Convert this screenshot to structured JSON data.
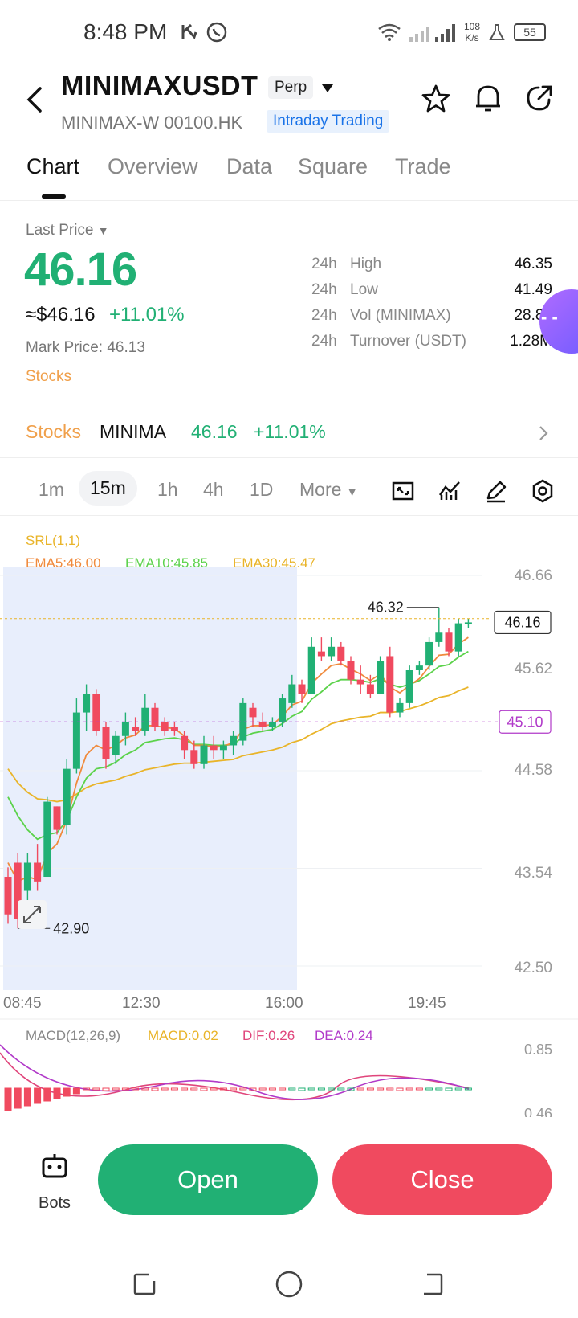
{
  "status": {
    "time": "8:48 PM",
    "net_speed_top": "108",
    "net_speed_bottom": "K/s",
    "battery": "55"
  },
  "header": {
    "title": "MINIMAXUSDT",
    "badge": "Perp",
    "subtitle": "MINIMAX-W 00100.HK",
    "tag": "Intraday Trading"
  },
  "tabs": [
    "Chart",
    "Overview",
    "Data",
    "Square",
    "Trade"
  ],
  "price": {
    "label": "Last Price",
    "value": "46.16",
    "usd": "≈$46.16",
    "change": "+11.01%",
    "mark": "Mark Price: 46.13",
    "category": "Stocks"
  },
  "stats": [
    {
      "p": "24h",
      "label": "High",
      "value": "46.35"
    },
    {
      "p": "24h",
      "label": "Low",
      "value": "41.49"
    },
    {
      "p": "24h",
      "label": "Vol (MINIMAX)",
      "value": "28.82"
    },
    {
      "p": "24h",
      "label": "Turnover (USDT)",
      "value": "1.28M"
    }
  ],
  "ticker": {
    "category": "Stocks",
    "name": "MINIMA",
    "price": "46.16",
    "change": "+11.01%"
  },
  "intervals": [
    "1m",
    "15m",
    "1h",
    "4h",
    "1D",
    "More"
  ],
  "colors": {
    "up": "#21b074",
    "down": "#f04a5f",
    "ema5": "#f08a3c",
    "ema10": "#5bd24a",
    "ema30": "#e9b429",
    "dif": "#e0457b",
    "dea": "#b13ac9"
  },
  "chart_data": {
    "type": "candlestick",
    "indicator_top": "SRL(1,1)",
    "legend": [
      "EMA5:46.00",
      "EMA10:45.85",
      "EMA30:45.47"
    ],
    "y_ticks": [
      "46.66",
      "45.62",
      "44.58",
      "43.54",
      "42.50"
    ],
    "x_ticks": [
      "08:45",
      "12:30",
      "16:00",
      "19:45"
    ],
    "ylim": [
      42.5,
      46.66
    ],
    "high_label": "46.32",
    "low_label": "42.90",
    "last_label": "46.16",
    "ref_label": "45.10",
    "macd_legend": [
      "MACD(12,26,9)",
      "MACD:0.02",
      "DIF:0.26",
      "DEA:0.24"
    ],
    "macd_ticks": [
      "0.85",
      "0.46"
    ],
    "candles": [
      {
        "o": 43.45,
        "h": 43.55,
        "l": 42.95,
        "c": 43.05
      },
      {
        "o": 43.6,
        "h": 43.7,
        "l": 42.9,
        "c": 43.0
      },
      {
        "o": 43.3,
        "h": 43.7,
        "l": 43.2,
        "c": 43.6
      },
      {
        "o": 43.6,
        "h": 43.8,
        "l": 43.3,
        "c": 43.4
      },
      {
        "o": 43.45,
        "h": 44.3,
        "l": 43.45,
        "c": 44.25
      },
      {
        "o": 44.2,
        "h": 44.2,
        "l": 43.9,
        "c": 43.95
      },
      {
        "o": 44.0,
        "h": 44.7,
        "l": 43.9,
        "c": 44.6
      },
      {
        "o": 44.6,
        "h": 45.35,
        "l": 44.55,
        "c": 45.2
      },
      {
        "o": 45.2,
        "h": 45.5,
        "l": 45.0,
        "c": 45.4
      },
      {
        "o": 45.4,
        "h": 45.45,
        "l": 44.95,
        "c": 45.0
      },
      {
        "o": 45.05,
        "h": 45.1,
        "l": 44.6,
        "c": 44.7
      },
      {
        "o": 44.75,
        "h": 45.0,
        "l": 44.65,
        "c": 44.95
      },
      {
        "o": 44.95,
        "h": 45.2,
        "l": 44.85,
        "c": 45.1
      },
      {
        "o": 45.05,
        "h": 45.15,
        "l": 44.95,
        "c": 45.0
      },
      {
        "o": 45.0,
        "h": 45.4,
        "l": 44.95,
        "c": 45.25
      },
      {
        "o": 45.25,
        "h": 45.3,
        "l": 45.0,
        "c": 45.05
      },
      {
        "o": 45.1,
        "h": 45.15,
        "l": 44.95,
        "c": 45.0
      },
      {
        "o": 45.05,
        "h": 45.1,
        "l": 44.95,
        "c": 45.0
      },
      {
        "o": 44.95,
        "h": 45.0,
        "l": 44.7,
        "c": 44.8
      },
      {
        "o": 44.8,
        "h": 44.9,
        "l": 44.6,
        "c": 44.65
      },
      {
        "o": 44.65,
        "h": 44.95,
        "l": 44.6,
        "c": 44.85
      },
      {
        "o": 44.85,
        "h": 44.95,
        "l": 44.7,
        "c": 44.8
      },
      {
        "o": 44.8,
        "h": 44.9,
        "l": 44.7,
        "c": 44.85
      },
      {
        "o": 44.85,
        "h": 45.0,
        "l": 44.75,
        "c": 44.95
      },
      {
        "o": 44.9,
        "h": 45.35,
        "l": 44.85,
        "c": 45.3
      },
      {
        "o": 45.25,
        "h": 45.3,
        "l": 45.05,
        "c": 45.15
      },
      {
        "o": 45.1,
        "h": 45.2,
        "l": 45.0,
        "c": 45.05
      },
      {
        "o": 45.05,
        "h": 45.15,
        "l": 45.0,
        "c": 45.1
      },
      {
        "o": 45.1,
        "h": 45.4,
        "l": 45.05,
        "c": 45.35
      },
      {
        "o": 45.3,
        "h": 45.6,
        "l": 45.25,
        "c": 45.5
      },
      {
        "o": 45.5,
        "h": 45.55,
        "l": 45.3,
        "c": 45.4
      },
      {
        "o": 45.4,
        "h": 46.0,
        "l": 45.4,
        "c": 45.9
      },
      {
        "o": 45.85,
        "h": 46.0,
        "l": 45.75,
        "c": 45.8
      },
      {
        "o": 45.8,
        "h": 46.0,
        "l": 45.75,
        "c": 45.9
      },
      {
        "o": 45.9,
        "h": 45.95,
        "l": 45.7,
        "c": 45.75
      },
      {
        "o": 45.75,
        "h": 45.8,
        "l": 45.5,
        "c": 45.55
      },
      {
        "o": 45.55,
        "h": 45.7,
        "l": 45.4,
        "c": 45.5
      },
      {
        "o": 45.5,
        "h": 45.6,
        "l": 45.35,
        "c": 45.4
      },
      {
        "o": 45.4,
        "h": 45.8,
        "l": 45.4,
        "c": 45.75
      },
      {
        "o": 45.8,
        "h": 45.9,
        "l": 45.15,
        "c": 45.2
      },
      {
        "o": 45.2,
        "h": 45.35,
        "l": 45.15,
        "c": 45.3
      },
      {
        "o": 45.3,
        "h": 45.7,
        "l": 45.25,
        "c": 45.65
      },
      {
        "o": 45.65,
        "h": 45.75,
        "l": 45.6,
        "c": 45.7
      },
      {
        "o": 45.7,
        "h": 46.0,
        "l": 45.65,
        "c": 45.95
      },
      {
        "o": 45.95,
        "h": 46.32,
        "l": 45.9,
        "c": 46.05
      },
      {
        "o": 46.05,
        "h": 46.1,
        "l": 45.8,
        "c": 45.85
      },
      {
        "o": 45.85,
        "h": 46.2,
        "l": 45.8,
        "c": 46.15
      },
      {
        "o": 46.14,
        "h": 46.2,
        "l": 46.1,
        "c": 46.16
      }
    ],
    "ema5": [
      43.6,
      43.4,
      43.45,
      43.42,
      43.7,
      43.8,
      44.05,
      44.45,
      44.75,
      44.85,
      44.8,
      44.85,
      44.93,
      44.96,
      45.06,
      45.06,
      45.04,
      45.03,
      44.95,
      44.85,
      44.85,
      44.83,
      44.84,
      44.88,
      45.02,
      45.06,
      45.06,
      45.07,
      45.16,
      45.28,
      45.32,
      45.51,
      45.61,
      45.7,
      45.72,
      45.66,
      45.61,
      45.54,
      45.61,
      45.47,
      45.41,
      45.49,
      45.56,
      45.69,
      45.81,
      45.82,
      45.93,
      46.0
    ],
    "ema10": [
      44.3,
      44.1,
      43.95,
      43.85,
      43.9,
      43.92,
      44.05,
      44.3,
      44.5,
      44.6,
      44.62,
      44.67,
      44.75,
      44.8,
      44.88,
      44.9,
      44.92,
      44.93,
      44.91,
      44.86,
      44.86,
      44.85,
      44.85,
      44.86,
      44.94,
      44.98,
      45.0,
      45.02,
      45.08,
      45.16,
      45.21,
      45.34,
      45.42,
      45.51,
      45.55,
      45.55,
      45.54,
      45.52,
      45.56,
      45.5,
      45.47,
      45.5,
      45.54,
      45.61,
      45.69,
      45.71,
      45.79,
      45.85
    ],
    "ema30": [
      44.6,
      44.45,
      44.35,
      44.28,
      44.27,
      44.25,
      44.27,
      44.33,
      44.4,
      44.44,
      44.46,
      44.48,
      44.52,
      44.55,
      44.59,
      44.61,
      44.63,
      44.65,
      44.66,
      44.66,
      44.67,
      44.68,
      44.69,
      44.7,
      44.74,
      44.76,
      44.78,
      44.8,
      44.83,
      44.88,
      44.91,
      44.97,
      45.02,
      45.08,
      45.11,
      45.13,
      45.15,
      45.16,
      45.2,
      45.2,
      45.21,
      45.24,
      45.27,
      45.31,
      45.36,
      45.38,
      45.43,
      45.47
    ]
  }
}
